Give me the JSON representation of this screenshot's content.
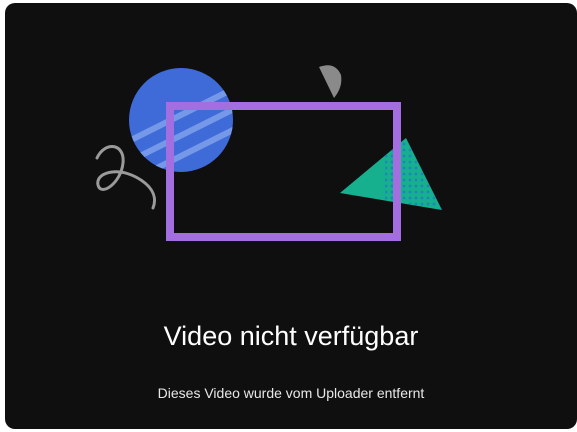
{
  "player": {
    "title": "Video nicht verfügbar",
    "subtitle": "Dieses Video wurde vom Uploader entfernt",
    "illustration": {
      "icons": [
        "blue-circle",
        "purple-rectangle",
        "green-triangle",
        "gray-half-circle",
        "squiggle-line"
      ],
      "colors": {
        "background": "#0f0f0f",
        "circle": "#3f6bd9",
        "circle_stripes": "#7fa0ec",
        "rectangle": "#a36ee0",
        "triangle": "#16b08e",
        "triangle_dots": "#1f7fbf",
        "half_circle": "#8a8a8a",
        "squiggle": "#9a9a9a"
      }
    }
  }
}
